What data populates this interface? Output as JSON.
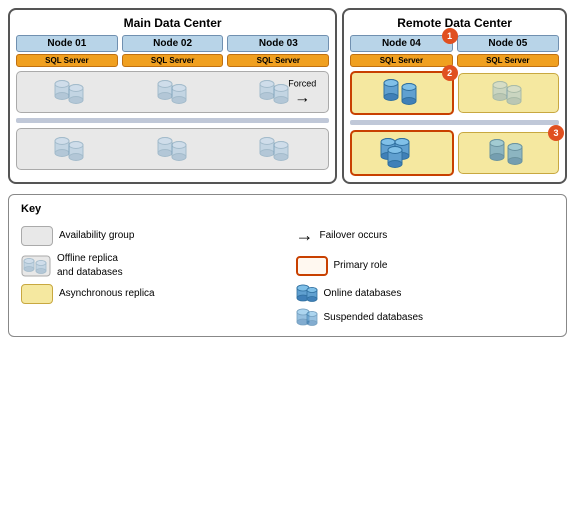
{
  "main_dc": {
    "label": "Main Data Center",
    "nodes": [
      {
        "id": "node01",
        "label": "Node 01",
        "sql": "SQL Server"
      },
      {
        "id": "node02",
        "label": "Node 02",
        "sql": "SQL Server"
      },
      {
        "id": "node03",
        "label": "Node 03",
        "sql": "SQL Server"
      }
    ]
  },
  "remote_dc": {
    "label": "Remote Data Center",
    "nodes": [
      {
        "id": "node04",
        "label": "Node 04",
        "sql": "SQL Server",
        "badge": "1"
      },
      {
        "id": "node05",
        "label": "Node 05",
        "sql": "SQL Server"
      }
    ]
  },
  "forced_label": "Forced",
  "arrow": "→",
  "badges": {
    "b1": "1",
    "b2": "2",
    "b3": "3"
  },
  "legend": {
    "title": "Key",
    "items": [
      {
        "icon": "ag",
        "text": "Availability group"
      },
      {
        "icon": "failover",
        "text": "Failover occurs"
      },
      {
        "icon": "offline",
        "text": "Offline replica\nand databases"
      },
      {
        "icon": "primary",
        "text": "Primary role"
      },
      {
        "icon": "async",
        "text": "Asynchronous replica"
      },
      {
        "icon": "online",
        "text": "Online databases"
      },
      {
        "icon": "blank",
        "text": ""
      },
      {
        "icon": "suspended",
        "text": "Suspended databases"
      }
    ]
  }
}
